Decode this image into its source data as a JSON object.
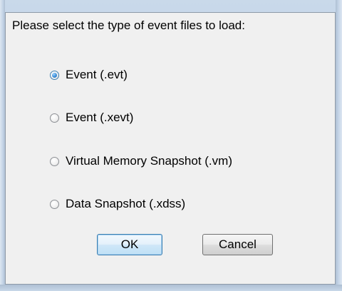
{
  "dialog": {
    "prompt": "Please select the type of event files to load:"
  },
  "options": [
    {
      "label": "Event (.evt)",
      "checked": true
    },
    {
      "label": "Event (.xevt)",
      "checked": false
    },
    {
      "label": "Virtual Memory Snapshot (.vm)",
      "checked": false
    },
    {
      "label": "Data Snapshot (.xdss)",
      "checked": false
    }
  ],
  "buttons": {
    "ok_label": "OK",
    "cancel_label": "Cancel"
  },
  "colors": {
    "frame": "#bcd0e6",
    "dialog_bg": "#f0f0f0",
    "accent": "#3c7fb1"
  }
}
